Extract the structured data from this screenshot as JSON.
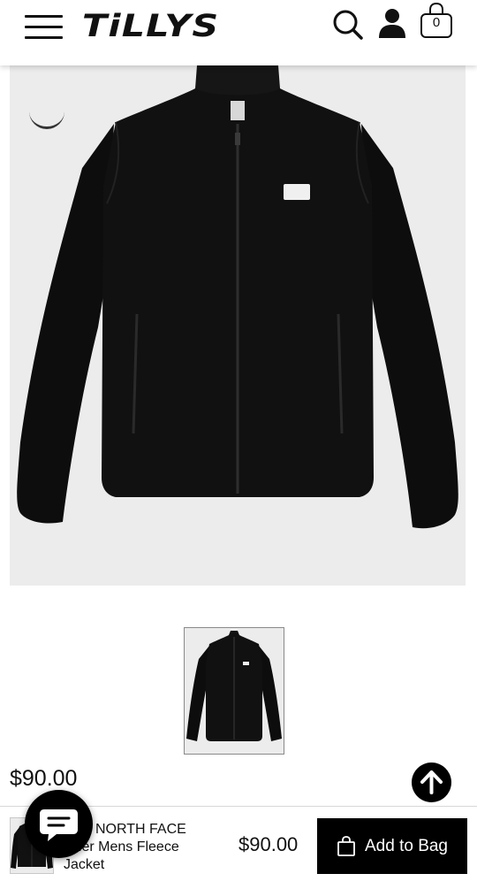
{
  "header": {
    "logo_text": "TiLLYS",
    "menu_icon": "hamburger-menu-icon",
    "search_icon": "search-icon",
    "account_icon": "account-icon",
    "bag_icon": "shopping-bag-icon",
    "bag_count": "0"
  },
  "product": {
    "hero_image": "black-fleece-jacket-image",
    "price": "$90.00"
  },
  "sticky_bar": {
    "name": "NORTH FACE Glacier Mens Fleece Jacket",
    "name_visible": "NORTH FACE\nacier Mens Fleece\nJacket",
    "price": "$90.00",
    "add_to_bag_label": "Add to Bag"
  },
  "colors": {
    "accent": "#000000",
    "background": "#ffffff",
    "image_bg": "#ececec"
  }
}
